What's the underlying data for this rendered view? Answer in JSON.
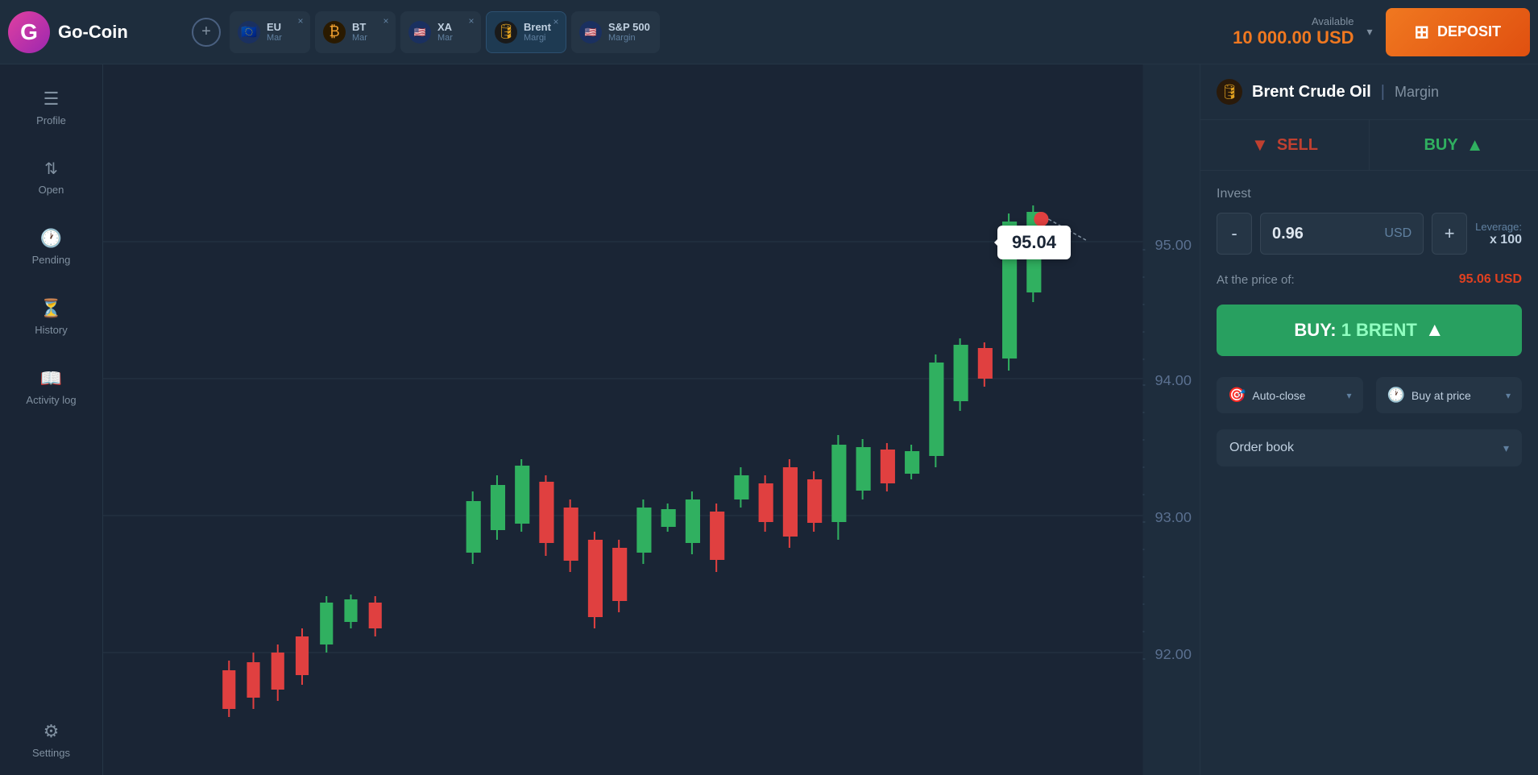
{
  "app": {
    "name": "Go-Coin",
    "logo_letter": "G"
  },
  "header": {
    "available_label": "Available",
    "available_amount": "10 000.00 USD",
    "deposit_label": "DEPOSIT",
    "add_tab_symbol": "+"
  },
  "tabs": [
    {
      "id": "eu",
      "short": "EU",
      "sub": "Mar",
      "icon": "🇪🇺",
      "active": false
    },
    {
      "id": "btc",
      "short": "BT",
      "sub": "Mar",
      "icon": "₿",
      "active": false
    },
    {
      "id": "xau",
      "short": "XA",
      "sub": "Mar",
      "icon": "🇺🇸",
      "active": false
    },
    {
      "id": "brent",
      "short": "Brent",
      "sub": "Margi",
      "icon": "🛢",
      "active": true
    },
    {
      "id": "sp500",
      "short": "S&P 500",
      "sub": "Margin",
      "icon": "🇺🇸",
      "active": false
    }
  ],
  "sidebar": {
    "items": [
      {
        "id": "profile",
        "label": "Profile",
        "icon": "☰",
        "active": false
      },
      {
        "id": "open",
        "label": "Open",
        "icon": "↕",
        "active": false
      },
      {
        "id": "pending",
        "label": "Pending",
        "icon": "🕐",
        "active": false
      },
      {
        "id": "history",
        "label": "History",
        "icon": "⏳",
        "active": false
      },
      {
        "id": "activity",
        "label": "Activity log",
        "icon": "📖",
        "active": false
      },
      {
        "id": "settings",
        "label": "Settings",
        "icon": "⚙",
        "active": false
      }
    ]
  },
  "chart": {
    "current_price": "95.04",
    "y_labels": [
      "95.00",
      "94.00",
      "93.00",
      "92.00"
    ]
  },
  "right_panel": {
    "asset_icon": "🛢",
    "asset_name": "Brent Crude Oil",
    "asset_divider": "|",
    "asset_type": "Margin",
    "sell_label": "SELL",
    "buy_label": "BUY",
    "invest_label": "Invest",
    "invest_minus": "-",
    "invest_plus": "+",
    "invest_value": "0.96",
    "invest_currency": "USD",
    "leverage_label": "Leverage:",
    "leverage_value": "x 100",
    "price_at_label": "At the price of:",
    "price_at_value": "95.06 USD",
    "buy_button_prefix": "BUY:",
    "buy_button_quantity": "1",
    "buy_button_asset": "BRENT",
    "auto_close_label": "Auto-close",
    "buy_at_price_label": "Buy at price",
    "order_book_label": "Order book"
  }
}
